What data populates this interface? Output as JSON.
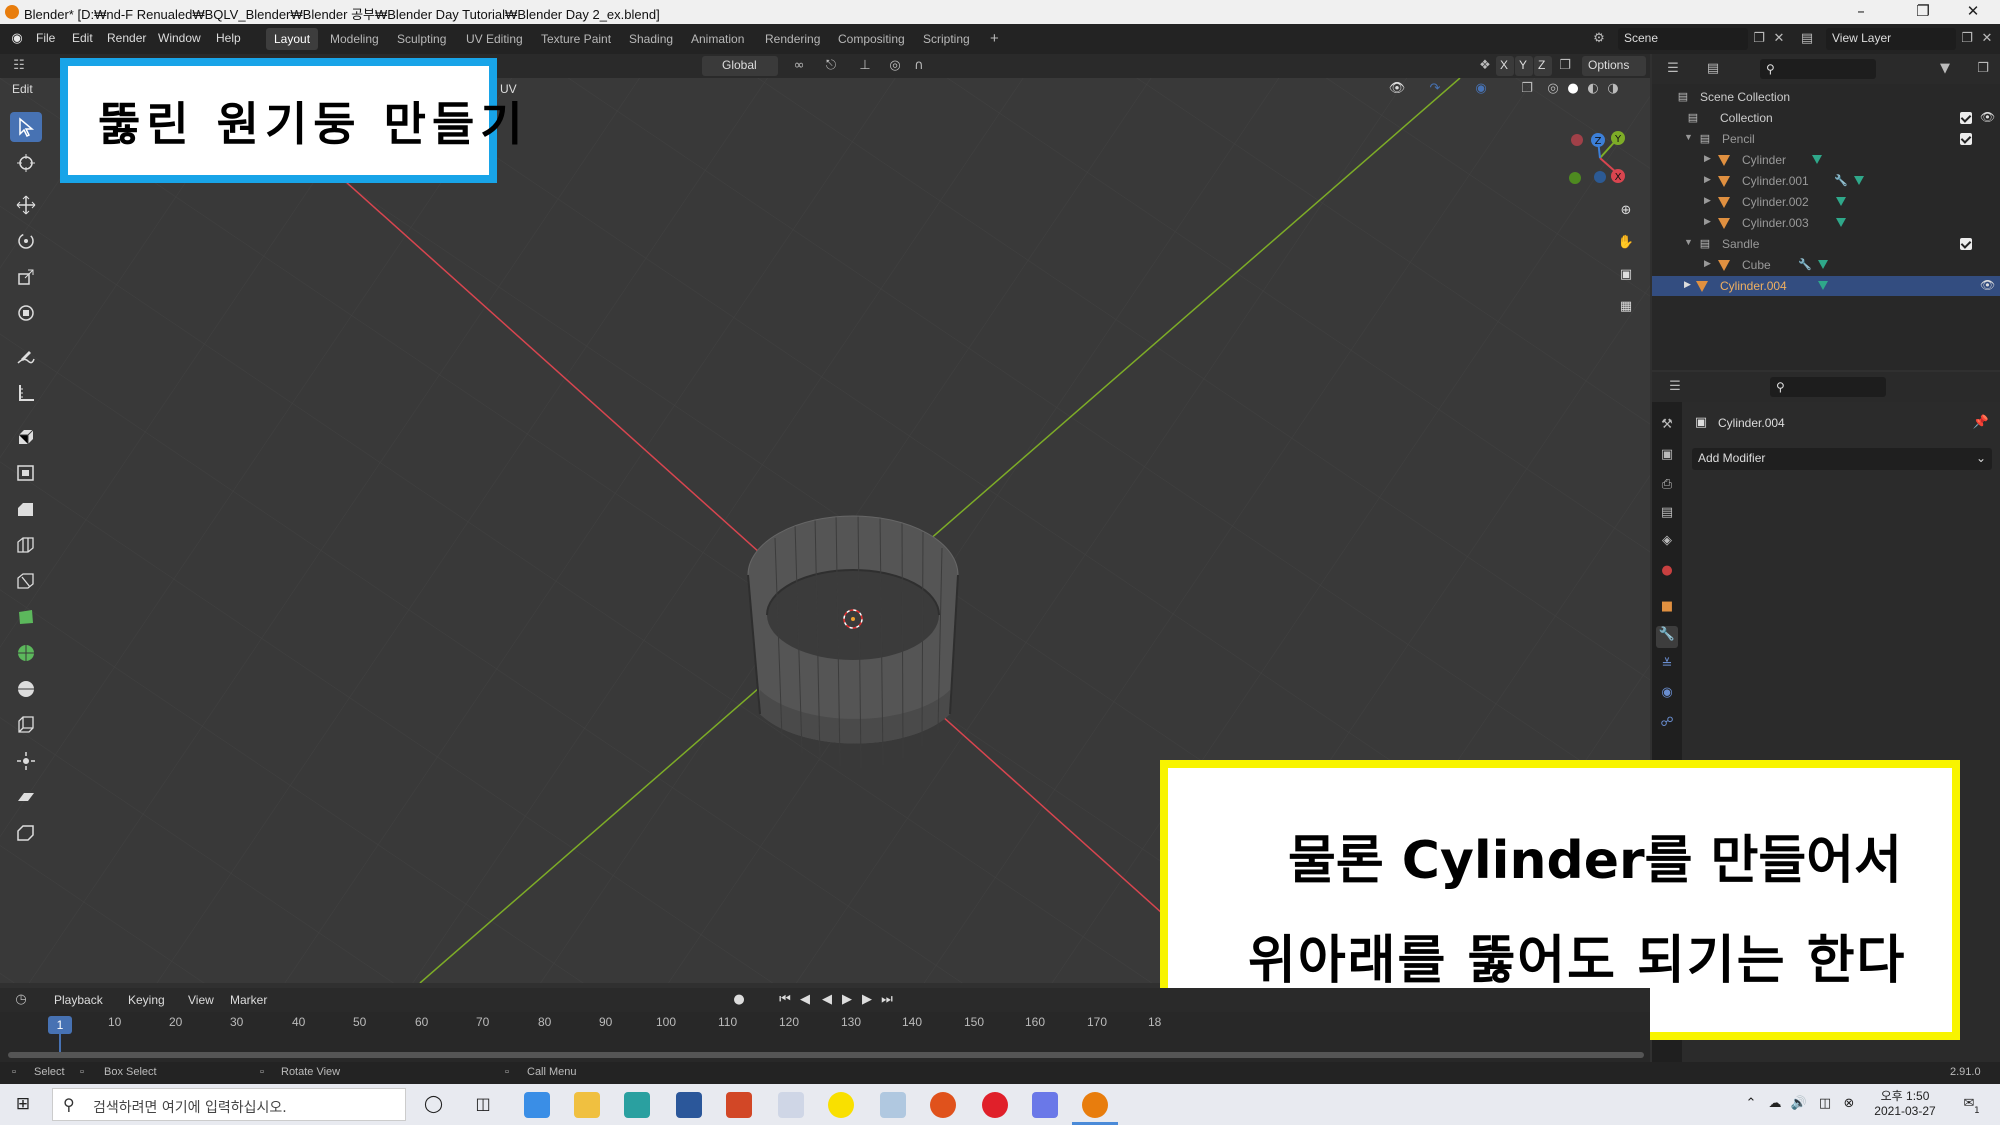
{
  "window": {
    "title": "Blender* [D:₩nd-F Renualed₩BQLV_Blender₩Blender 공부₩Blender Day Tutorial₩Blender Day 2_ex.blend]",
    "controls": [
      "–",
      "❐",
      "✕"
    ]
  },
  "menu": [
    "File",
    "Edit",
    "Render",
    "Window",
    "Help"
  ],
  "workspace_tabs": [
    {
      "label": "Layout",
      "active": true
    },
    {
      "label": "Modeling"
    },
    {
      "label": "Sculpting"
    },
    {
      "label": "UV Editing"
    },
    {
      "label": "Texture Paint"
    },
    {
      "label": "Shading"
    },
    {
      "label": "Animation"
    },
    {
      "label": "Rendering"
    },
    {
      "label": "Compositing"
    },
    {
      "label": "Scripting"
    }
  ],
  "add_workspace": "+",
  "scene": {
    "label": "Scene"
  },
  "view_layer": {
    "label": "View Layer"
  },
  "viewport_header": {
    "mode_partial": "Edit",
    "uv_partial": "UV",
    "transform_orientation": "Global",
    "axes": [
      "X",
      "Y",
      "Z"
    ],
    "options_label": "Options"
  },
  "gizmo": {
    "x": "X",
    "y": "Y",
    "z": "Z"
  },
  "outliner": {
    "search_placeholder": "",
    "rows": [
      {
        "label": "Scene Collection",
        "kind": "scene"
      },
      {
        "label": "Collection",
        "kind": "collection"
      },
      {
        "label": "Pencil",
        "kind": "collection"
      },
      {
        "label": "Cylinder",
        "kind": "object"
      },
      {
        "label": "Cylinder.001",
        "kind": "object"
      },
      {
        "label": "Cylinder.002",
        "kind": "object"
      },
      {
        "label": "Cylinder.003",
        "kind": "object"
      },
      {
        "label": "Sandle",
        "kind": "collection"
      },
      {
        "label": "Cube",
        "kind": "object"
      },
      {
        "label": "Cylinder.004",
        "kind": "object",
        "selected": true
      }
    ]
  },
  "properties": {
    "object_name": "Cylinder.004",
    "add_modifier": "Add Modifier"
  },
  "timeline": {
    "menu": [
      "Playback",
      "Keying",
      "View",
      "Marker"
    ],
    "current_frame": "1",
    "frames": [
      "10",
      "20",
      "30",
      "40",
      "50",
      "60",
      "70",
      "80",
      "90",
      "100",
      "110",
      "120",
      "130",
      "140",
      "150",
      "160",
      "170",
      "18"
    ]
  },
  "statusbar": {
    "select": "Select",
    "box_select": "Box Select",
    "rotate_view": "Rotate View",
    "call_menu": "Call Menu",
    "version": "2.91.0"
  },
  "taskbar": {
    "search_placeholder": "검색하려면 여기에 입력하십시오.",
    "time": "오후 1:50",
    "date": "2021-03-27",
    "notif_count": "1"
  },
  "captions": {
    "top_left": "뚫린 원기둥 만들기",
    "bottom_right_line1": "물론 Cylinder를 만들어서",
    "bottom_right_line2": "위아래를 뚫어도 되기는 한다"
  },
  "colors": {
    "accent": "#4772b3",
    "x_axis": "#d8454f",
    "y_axis": "#7dac27",
    "caption1_border": "#18a4e8",
    "caption2_border": "#f8f400"
  }
}
